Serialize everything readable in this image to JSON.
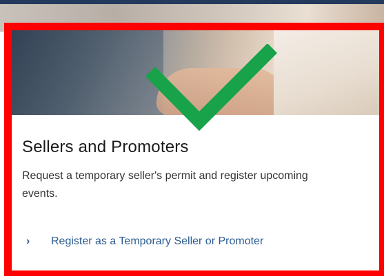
{
  "card": {
    "title": "Sellers and Promoters",
    "description": "Request a temporary seller's permit and register upcoming events.",
    "link_chevron": "›",
    "link_label": "Register as a Temporary Seller or Promoter"
  },
  "annotations": {
    "border_color": "#ff0000",
    "check_color": "#18a24a"
  },
  "colors": {
    "link": "#2c5c91",
    "heading": "#1a1a1a",
    "top_strip": "#243a5c"
  }
}
